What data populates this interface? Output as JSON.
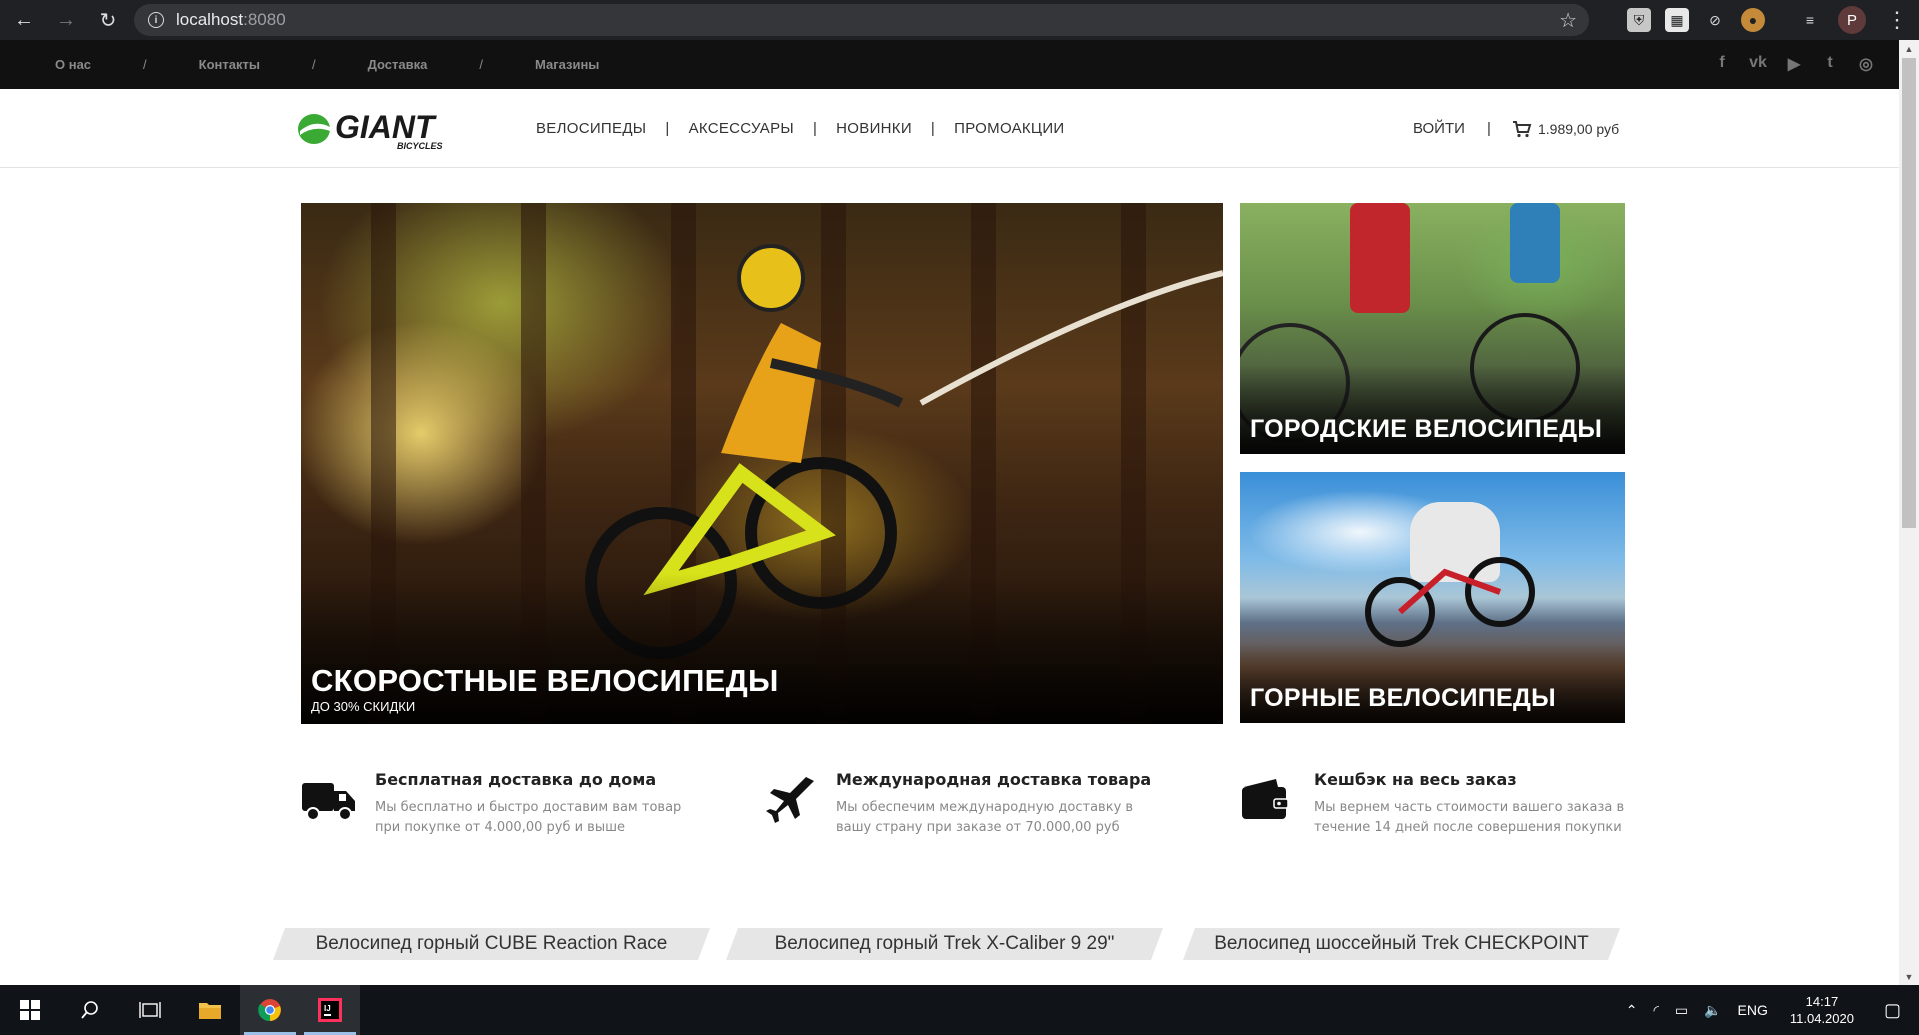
{
  "browser": {
    "url_host": "localhost",
    "url_port": ":8080",
    "profile_initial": "P"
  },
  "topbar": {
    "links": [
      "О нас",
      "Контакты",
      "Доставка",
      "Магазины"
    ],
    "separator": "/",
    "socials": [
      "f",
      "vk",
      "▶",
      "t",
      "◎"
    ]
  },
  "header": {
    "logo_text": "GIANT",
    "logo_sub": "BICYCLES",
    "nav": [
      "ВЕЛОСИПЕДЫ",
      "АКСЕССУАРЫ",
      "НОВИНКИ",
      "ПРОМОАКЦИИ"
    ],
    "nav_separator": "|",
    "login": "ВОЙТИ",
    "cart_total": "1.989,00 руб"
  },
  "banners": {
    "speed": {
      "title": "СКОРОСТНЫЕ ВЕЛОСИПЕДЫ",
      "subtitle": "ДО 30% СКИДКИ"
    },
    "city": {
      "title": "ГОРОДСКИЕ ВЕЛОСИПЕДЫ"
    },
    "mountain": {
      "title": "ГОРНЫЕ ВЕЛОСИПЕДЫ"
    }
  },
  "features": [
    {
      "icon": "truck-icon",
      "title": "Бесплатная доставка до дома",
      "text": "Мы бесплатно и быстро доставим вам товар при покупке от 4.000,00 руб и выше"
    },
    {
      "icon": "plane-icon",
      "title": "Международная доставка товара",
      "text": "Мы обеспечим международную доставку в вашу страну при заказе от 70.000,00 руб"
    },
    {
      "icon": "wallet-icon",
      "title": "Кешбэк на весь заказ",
      "text": "Мы вернем часть стоимости вашего заказа в течение 14 дней после совершения покупки"
    }
  ],
  "products": [
    "Велосипед горный CUBE Reaction Race",
    "Велосипед горный Trek X-Caliber 9 29\"",
    "Велосипед шоссейный Trek CHECKPOINT"
  ],
  "taskbar": {
    "language": "ENG",
    "time": "14:17",
    "date": "11.04.2020"
  },
  "colors": {
    "topbar_bg": "#111111",
    "logo_green": "#3aaa35",
    "taskbar_bg": "#101418"
  }
}
